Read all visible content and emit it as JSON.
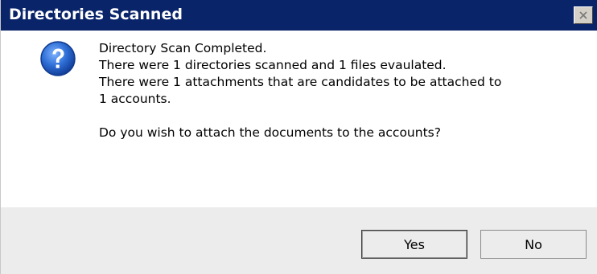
{
  "window": {
    "title": "Directories Scanned",
    "close_icon": "close-icon"
  },
  "dialog": {
    "icon": "question-icon",
    "message_lines": [
      "Directory Scan Completed.",
      "There were 1 directories scanned and 1 files evaulated.",
      "There were 1 attachments that are candidates to be attached to",
      "1 accounts.",
      "",
      "Do you wish to attach the documents to the accounts?"
    ]
  },
  "buttons": {
    "yes_label": "Yes",
    "no_label": "No"
  },
  "colors": {
    "titlebar": "#0a246a",
    "title_text": "#ffffff",
    "icon_blue": "#1f5fbf",
    "footer": "#ececec"
  }
}
